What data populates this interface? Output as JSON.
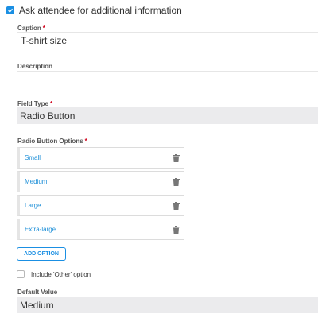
{
  "ask_attendee": {
    "label": "Ask attendee for additional information",
    "checked": true
  },
  "caption": {
    "label": "Caption",
    "required": "*",
    "value": "T-shirt size"
  },
  "description": {
    "label": "Description",
    "value": ""
  },
  "field_type": {
    "label": "Field Type",
    "required": "*",
    "value": "Radio Button"
  },
  "radio_options": {
    "label": "Radio Button Options",
    "required": "*",
    "items": [
      {
        "label": "Small",
        "icon": "trash-icon"
      },
      {
        "label": "Medium",
        "icon": "trash-icon"
      },
      {
        "label": "Large",
        "icon": "trash-icon"
      },
      {
        "label": "Extra-large",
        "icon": "trash-icon"
      }
    ]
  },
  "add_option": {
    "label": "ADD OPTION"
  },
  "include_other": {
    "label": "Include 'Other' option",
    "checked": false
  },
  "default_value": {
    "label": "Default Value",
    "value": "Medium"
  },
  "colors": {
    "accent": "#1a8fe3",
    "required": "#d0021b",
    "link": "#1d8fd8"
  }
}
